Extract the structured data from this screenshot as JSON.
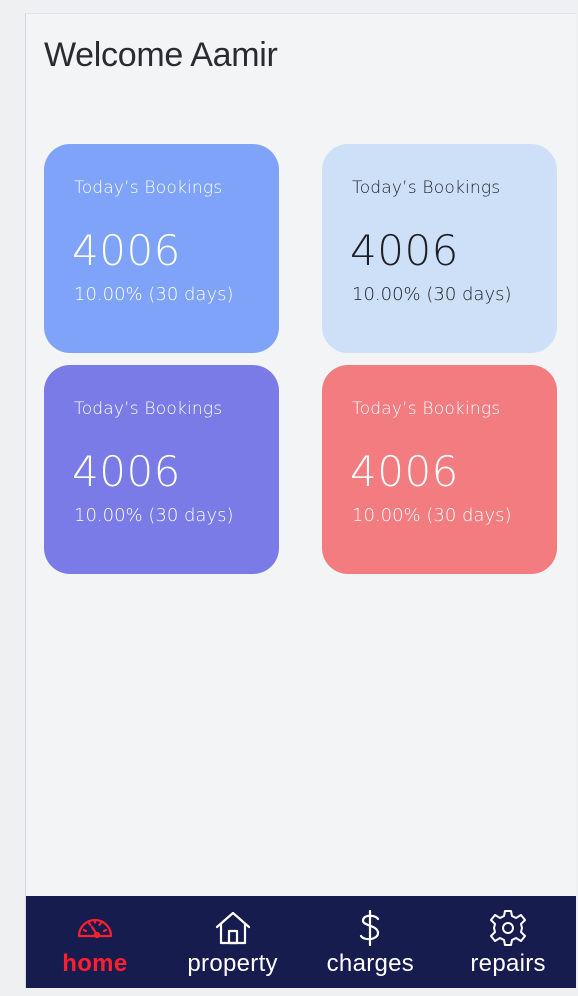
{
  "header": {
    "welcome": "Welcome Aamir"
  },
  "cards": [
    {
      "title": "Today’s Bookings",
      "value": "4006",
      "sub": "10.00% (30 days)",
      "color": "#7ea3f8"
    },
    {
      "title": "Today’s Bookings",
      "value": "4006",
      "sub": "10.00% (30 days)",
      "color": "#cde0f8"
    },
    {
      "title": "Today’s Bookings",
      "value": "4006",
      "sub": "10.00% (30 days)",
      "color": "#7a7be6"
    },
    {
      "title": "Today’s Bookings",
      "value": "4006",
      "sub": "10.00% (30 days)",
      "color": "#f27c80"
    }
  ],
  "nav": {
    "background": "#161c4e",
    "active_color": "#ff1f2f",
    "items": [
      {
        "label": "home",
        "icon": "gauge-icon",
        "active": true
      },
      {
        "label": "property",
        "icon": "house-icon",
        "active": false
      },
      {
        "label": "charges",
        "icon": "dollar-icon",
        "active": false
      },
      {
        "label": "repairs",
        "icon": "gear-icon",
        "active": false
      }
    ]
  }
}
